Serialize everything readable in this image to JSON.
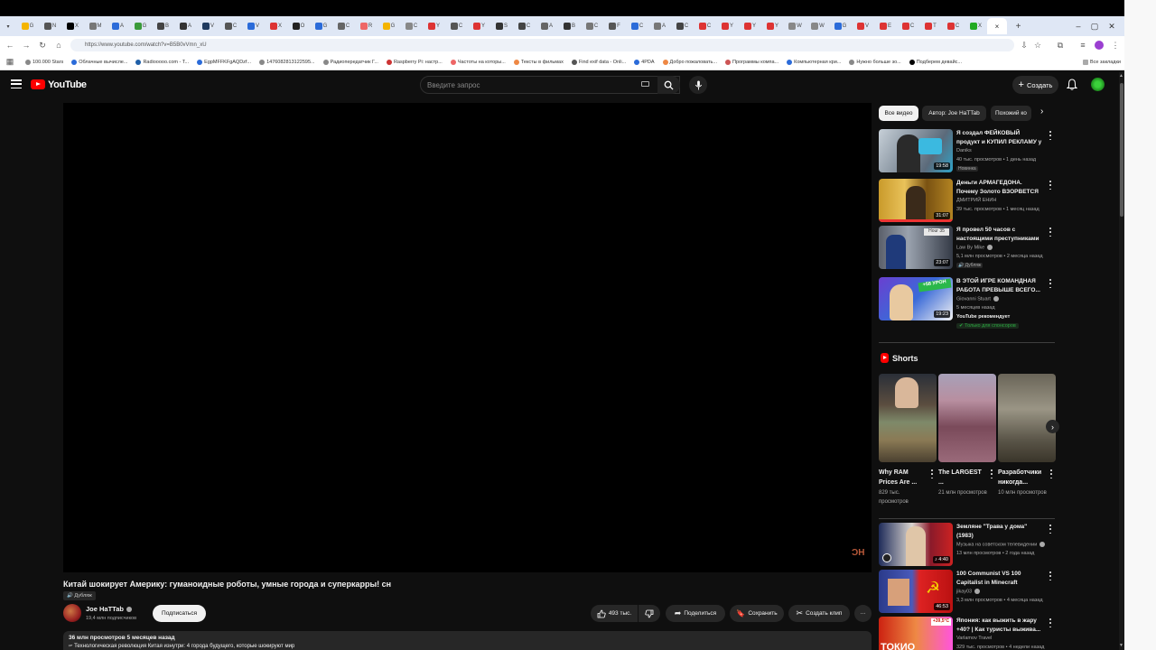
{
  "browser": {
    "url": "https://www.youtube.com/watch?v=B5B0vVmn_xU",
    "tabs": [
      "G",
      "N",
      "X",
      "M",
      "A",
      "",
      "B",
      "A",
      "V",
      "",
      "",
      "",
      "",
      "",
      "",
      "",
      "",
      "",
      "",
      "",
      "",
      "",
      "",
      "",
      "",
      "",
      "",
      "",
      "",
      "",
      "",
      "",
      "",
      "",
      "",
      "",
      "",
      "",
      "",
      "",
      "",
      ""
    ],
    "bookmarks": [
      "100.000 Stars",
      "Облачные вычисле...",
      "Radiooooo.com - T...",
      "EgpMFFKFgAQDzf...",
      "1476082813122595...",
      "Радиопередатчик Г...",
      "Raspberry Pi: настр...",
      "Частоты на которы...",
      "Тексты в фильмах",
      "Find exif data - Onli...",
      "4PDA",
      "Добро пожаловать...",
      "Программы компа...",
      "Компьютерная кри...",
      "Нужно больше зо...",
      "Подберем девайс..."
    ],
    "all_bookmarks": "Все закладки",
    "close_tab": "×",
    "new_tab": "+"
  },
  "header": {
    "logo_text": "YouTube",
    "search_placeholder": "Введите запрос",
    "create_label": "Создать"
  },
  "video": {
    "title": "Китай шокирует Америку: гуманоидные роботы, умные города и суперкарры! сн",
    "dub_badge": "Дубляж",
    "watermark": "ƆH",
    "channel_name": "Joe HaTTab",
    "subscribers": "19,4 млн подписчиков",
    "subscribe_label": "Подписаться",
    "likes": "493 тыс.",
    "share_label": "Поделиться",
    "save_label": "Сохранить",
    "clip_label": "Создать клип",
    "more_label": "···",
    "views_date": "36 млн просмотров  5 месяцев назад",
    "description_line": "Технологическая революция Китая изнутри: 4 города будущего, которые шокируют мир"
  },
  "chips": [
    "Все видео",
    "Автор: Joe HaTTab",
    "Похожий ко"
  ],
  "recommendations_top": [
    {
      "title": "Я создал ФЕЙКОВЫЙ продукт и КУПИЛ РЕКЛАМУ у ...",
      "channel": "Daniks",
      "meta": "40 тыс. просмотров • 1 день назад",
      "badge": "Новинка",
      "duration": "19:58"
    },
    {
      "title": "Деньги АРМАГЕДОНА. Почему Золото ВЗОРВЕТСЯ ...",
      "channel": "ДМИТРИЙ ЕНИН",
      "meta": "39 тыс. просмотров • 1 месяц назад",
      "badge": "",
      "duration": "31:07"
    },
    {
      "title": "Я провел 50 часов с настоящими преступниками",
      "channel": "Law By Mike",
      "meta": "5,1 млн просмотров • 2 месяца назад",
      "badge": "Дубляж",
      "duration": "23:07"
    },
    {
      "title": "В ЭТОЙ ИГРЕ КОМАНДНАЯ РАБОТА ПРЕВЫШЕ ВСЕГО...",
      "channel": "Giovanni Stuart",
      "meta": "5 месяцев назад",
      "badge2": "YouTube рекомендует",
      "badge3": "Только для спонсоров",
      "duration": "19:23"
    }
  ],
  "shorts": {
    "heading": "Shorts",
    "items": [
      {
        "title": "Why RAM Prices Are ...",
        "views": "829 тыс. просмотров"
      },
      {
        "title": "The LARGEST ...",
        "views": "21 млн просмотров"
      },
      {
        "title": "Разработчики никогда...",
        "views": "10 млн просмотров"
      }
    ]
  },
  "recommendations_bottom": [
    {
      "title": "Земляне \"Трава у дома\" (1983)",
      "channel": "Музыка на советском телевидении",
      "meta": "13 млн просмотров • 2 года назад",
      "duration": "4:40"
    },
    {
      "title": "100 Communist VS 100 Capitalist in Minecraft",
      "channel": "jikay03",
      "meta": "3,3 млн просмотров • 4 месяца назад",
      "duration": "46:53"
    },
    {
      "title": "Япония: как выжить в жару +40? | Как туристы выжива...",
      "channel": "Varlamov Travel",
      "meta": "329 тыс. просмотров • 4 недели назад",
      "duration": ""
    }
  ]
}
